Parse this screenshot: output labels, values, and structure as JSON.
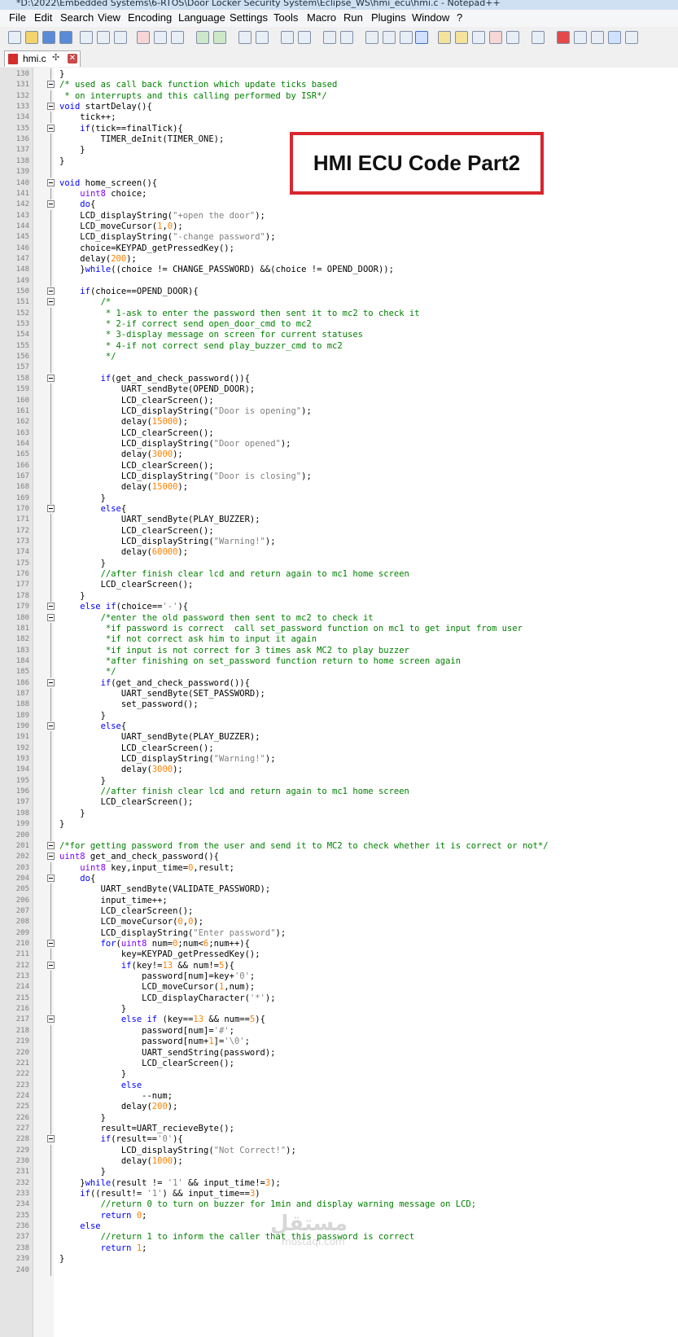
{
  "window": {
    "title": "*D:\\2022\\Embedded Systems\\6-RTOS\\Door Locker Security System\\Eclipse_WS\\hmi_ecu\\hmi.c - Notepad++"
  },
  "menu": [
    "File",
    "Edit",
    "Search",
    "View",
    "Encoding",
    "Language",
    "Settings",
    "Tools",
    "Macro",
    "Run",
    "Plugins",
    "Window",
    "?"
  ],
  "tab": {
    "filename": "hmi.c",
    "pin_icon": "pin-icon",
    "close_icon": "close-icon"
  },
  "annotation": {
    "text": "HMI ECU Code Part2"
  },
  "watermark": {
    "text": "مستقل",
    "sub": "mostaql.com"
  },
  "code": {
    "lines": [
      {
        "n": "130",
        "t": "}"
      },
      {
        "n": "131",
        "t": "/* used as call back function which update ticks based"
      },
      {
        "n": "132",
        "t": " * on interrupts and this calling performed by ISR*/"
      },
      {
        "n": "133",
        "t": "void startDelay(){"
      },
      {
        "n": "134",
        "t": "    tick++;"
      },
      {
        "n": "135",
        "t": "    if(tick==finalTick){"
      },
      {
        "n": "136",
        "t": "        TIMER_deInit(TIMER_ONE);"
      },
      {
        "n": "137",
        "t": "    }"
      },
      {
        "n": "138",
        "t": "}"
      },
      {
        "n": "139",
        "t": ""
      },
      {
        "n": "140",
        "t": "void home_screen(){"
      },
      {
        "n": "141",
        "t": "    uint8 choice;"
      },
      {
        "n": "142",
        "t": "    do{"
      },
      {
        "n": "143",
        "t": "    LCD_displayString(\"+open the door\");"
      },
      {
        "n": "144",
        "t": "    LCD_moveCursor(1,0);"
      },
      {
        "n": "145",
        "t": "    LCD_displayString(\"-change password\");"
      },
      {
        "n": "146",
        "t": "    choice=KEYPAD_getPressedKey();"
      },
      {
        "n": "147",
        "t": "    delay(200);"
      },
      {
        "n": "148",
        "t": "    }while((choice != CHANGE_PASSWORD) &&(choice != OPEND_DOOR));"
      },
      {
        "n": "149",
        "t": ""
      },
      {
        "n": "150",
        "t": "    if(choice==OPEND_DOOR){"
      },
      {
        "n": "151",
        "t": "        /*"
      },
      {
        "n": "152",
        "t": "         * 1-ask to enter the password then sent it to mc2 to check it"
      },
      {
        "n": "153",
        "t": "         * 2-if correct send open_door_cmd to mc2"
      },
      {
        "n": "154",
        "t": "         * 3-display message on screen for current statuses"
      },
      {
        "n": "155",
        "t": "         * 4-if not correct send play_buzzer_cmd to mc2"
      },
      {
        "n": "156",
        "t": "         */"
      },
      {
        "n": "157",
        "t": ""
      },
      {
        "n": "158",
        "t": "        if(get_and_check_password()){"
      },
      {
        "n": "159",
        "t": "            UART_sendByte(OPEND_DOOR);"
      },
      {
        "n": "160",
        "t": "            LCD_clearScreen();"
      },
      {
        "n": "161",
        "t": "            LCD_displayString(\"Door is opening\");"
      },
      {
        "n": "162",
        "t": "            delay(15000);"
      },
      {
        "n": "163",
        "t": "            LCD_clearScreen();"
      },
      {
        "n": "164",
        "t": "            LCD_displayString(\"Door opened\");"
      },
      {
        "n": "165",
        "t": "            delay(3000);"
      },
      {
        "n": "166",
        "t": "            LCD_clearScreen();"
      },
      {
        "n": "167",
        "t": "            LCD_displayString(\"Door is closing\");"
      },
      {
        "n": "168",
        "t": "            delay(15000);"
      },
      {
        "n": "169",
        "t": "        }"
      },
      {
        "n": "170",
        "t": "        else{"
      },
      {
        "n": "171",
        "t": "            UART_sendByte(PLAY_BUZZER);"
      },
      {
        "n": "172",
        "t": "            LCD_clearScreen();"
      },
      {
        "n": "173",
        "t": "            LCD_displayString(\"Warning!\");"
      },
      {
        "n": "174",
        "t": "            delay(60000);"
      },
      {
        "n": "175",
        "t": "        }"
      },
      {
        "n": "176",
        "t": "        //after finish clear lcd and return again to mc1 home screen"
      },
      {
        "n": "177",
        "t": "        LCD_clearScreen();"
      },
      {
        "n": "178",
        "t": "    }"
      },
      {
        "n": "179",
        "t": "    else if(choice=='-'){"
      },
      {
        "n": "180",
        "t": "        /*enter the old password then sent to mc2 to check it"
      },
      {
        "n": "181",
        "t": "         *if password is correct  call set_password function on mc1 to get input from user"
      },
      {
        "n": "182",
        "t": "         *if not correct ask him to input it again"
      },
      {
        "n": "183",
        "t": "         *if input is not correct for 3 times ask MC2 to play buzzer"
      },
      {
        "n": "184",
        "t": "         *after finishing on set_password function return to home screen again"
      },
      {
        "n": "185",
        "t": "         */"
      },
      {
        "n": "186",
        "t": "        if(get_and_check_password()){"
      },
      {
        "n": "187",
        "t": "            UART_sendByte(SET_PASSWORD);"
      },
      {
        "n": "188",
        "t": "            set_password();"
      },
      {
        "n": "189",
        "t": "        }"
      },
      {
        "n": "190",
        "t": "        else{"
      },
      {
        "n": "191",
        "t": "            UART_sendByte(PLAY_BUZZER);"
      },
      {
        "n": "192",
        "t": "            LCD_clearScreen();"
      },
      {
        "n": "193",
        "t": "            LCD_displayString(\"Warning!\");"
      },
      {
        "n": "194",
        "t": "            delay(3000);"
      },
      {
        "n": "195",
        "t": "        }"
      },
      {
        "n": "196",
        "t": "        //after finish clear lcd and return again to mc1 home screen"
      },
      {
        "n": "197",
        "t": "        LCD_clearScreen();"
      },
      {
        "n": "198",
        "t": "    }"
      },
      {
        "n": "199",
        "t": "}"
      },
      {
        "n": "200",
        "t": ""
      },
      {
        "n": "201",
        "t": "/*for getting password from the user and send it to MC2 to check whether it is correct or not*/"
      },
      {
        "n": "202",
        "t": "uint8 get_and_check_password(){"
      },
      {
        "n": "203",
        "t": "    uint8 key,input_time=0,result;"
      },
      {
        "n": "204",
        "t": "    do{"
      },
      {
        "n": "205",
        "t": "        UART_sendByte(VALIDATE_PASSWORD);"
      },
      {
        "n": "206",
        "t": "        input_time++;"
      },
      {
        "n": "207",
        "t": "        LCD_clearScreen();"
      },
      {
        "n": "208",
        "t": "        LCD_moveCursor(0,0);"
      },
      {
        "n": "209",
        "t": "        LCD_displayString(\"Enter password\");"
      },
      {
        "n": "210",
        "t": "        for(uint8 num=0;num<6;num++){"
      },
      {
        "n": "211",
        "t": "            key=KEYPAD_getPressedKey();"
      },
      {
        "n": "212",
        "t": "            if(key!=13 && num!=5){"
      },
      {
        "n": "213",
        "t": "                password[num]=key+'0';"
      },
      {
        "n": "214",
        "t": "                LCD_moveCursor(1,num);"
      },
      {
        "n": "215",
        "t": "                LCD_displayCharacter('*');"
      },
      {
        "n": "216",
        "t": "            }"
      },
      {
        "n": "217",
        "t": "            else if (key==13 && num==5){"
      },
      {
        "n": "218",
        "t": "                password[num]='#';"
      },
      {
        "n": "219",
        "t": "                password[num+1]='\\0';"
      },
      {
        "n": "220",
        "t": "                UART_sendString(password);"
      },
      {
        "n": "221",
        "t": "                LCD_clearScreen();"
      },
      {
        "n": "222",
        "t": "            }"
      },
      {
        "n": "223",
        "t": "            else"
      },
      {
        "n": "224",
        "t": "                --num;"
      },
      {
        "n": "225",
        "t": "            delay(200);"
      },
      {
        "n": "226",
        "t": "        }"
      },
      {
        "n": "227",
        "t": "        result=UART_recieveByte();"
      },
      {
        "n": "228",
        "t": "        if(result=='0'){"
      },
      {
        "n": "229",
        "t": "            LCD_displayString(\"Not Correct!\");"
      },
      {
        "n": "230",
        "t": "            delay(1000);"
      },
      {
        "n": "231",
        "t": "        }"
      },
      {
        "n": "232",
        "t": "    }while(result != '1' && input_time!=3);"
      },
      {
        "n": "233",
        "t": "    if((result!= '1') && input_time==3)"
      },
      {
        "n": "234",
        "t": "        //return 0 to turn on buzzer for 1min and display warning message on LCD;"
      },
      {
        "n": "235",
        "t": "        return 0;"
      },
      {
        "n": "236",
        "t": "    else"
      },
      {
        "n": "237",
        "t": "        //return 1 to inform the caller that this password is correct"
      },
      {
        "n": "238",
        "t": "        return 1;"
      },
      {
        "n": "239",
        "t": "}"
      },
      {
        "n": "240",
        "t": ""
      }
    ]
  },
  "colors": {
    "keyword": "#0000ff",
    "comment": "#008000",
    "string": "#808080",
    "number": "#ff8000",
    "type": "#8000ff"
  }
}
